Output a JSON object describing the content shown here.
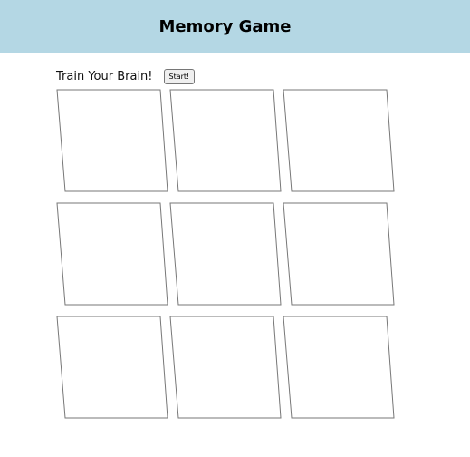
{
  "header": {
    "title": "Memory Game",
    "background_color": "#b4d7e4"
  },
  "controls": {
    "tagline": "Train Your Brain!",
    "start_label": "Start!"
  },
  "board": {
    "rows": 3,
    "columns": 3,
    "cards": [
      {
        "state": "face-down"
      },
      {
        "state": "face-down"
      },
      {
        "state": "face-down"
      },
      {
        "state": "face-down"
      },
      {
        "state": "face-down"
      },
      {
        "state": "face-down"
      },
      {
        "state": "face-down"
      },
      {
        "state": "face-down"
      },
      {
        "state": "face-down"
      }
    ]
  }
}
